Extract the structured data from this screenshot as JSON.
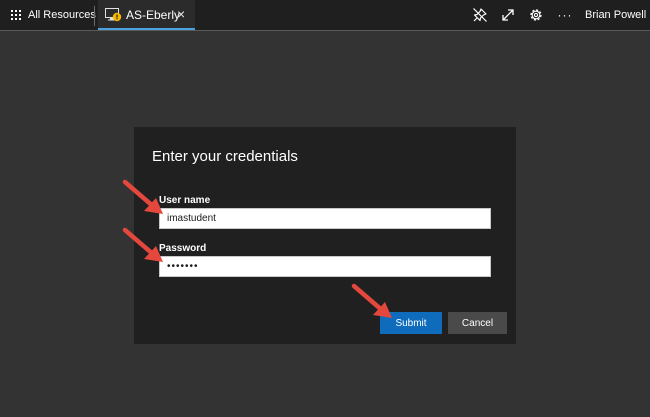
{
  "topbar": {
    "all_resources_label": "All Resources",
    "tab": {
      "label": "AS-Eberly",
      "close_glyph": "×",
      "icon": "monitor-warning-icon"
    },
    "icons": [
      "pin-off-icon",
      "expand-icon",
      "gear-icon",
      "more-icon"
    ],
    "more_glyph": "···",
    "user_name": "Brian Powell"
  },
  "dialog": {
    "title": "Enter your credentials",
    "username_label": "User name",
    "username_value": "imastudent",
    "password_label": "Password",
    "password_value": "1234567",
    "submit_label": "Submit",
    "cancel_label": "Cancel"
  },
  "colors": {
    "background": "#333333",
    "topbar": "#1f1f1f",
    "dialog": "#202020",
    "accent": "#0f6cbd",
    "tab_underline": "#4aa3df",
    "annotation_arrow": "#e4473c",
    "warning_badge": "#f5b700"
  }
}
